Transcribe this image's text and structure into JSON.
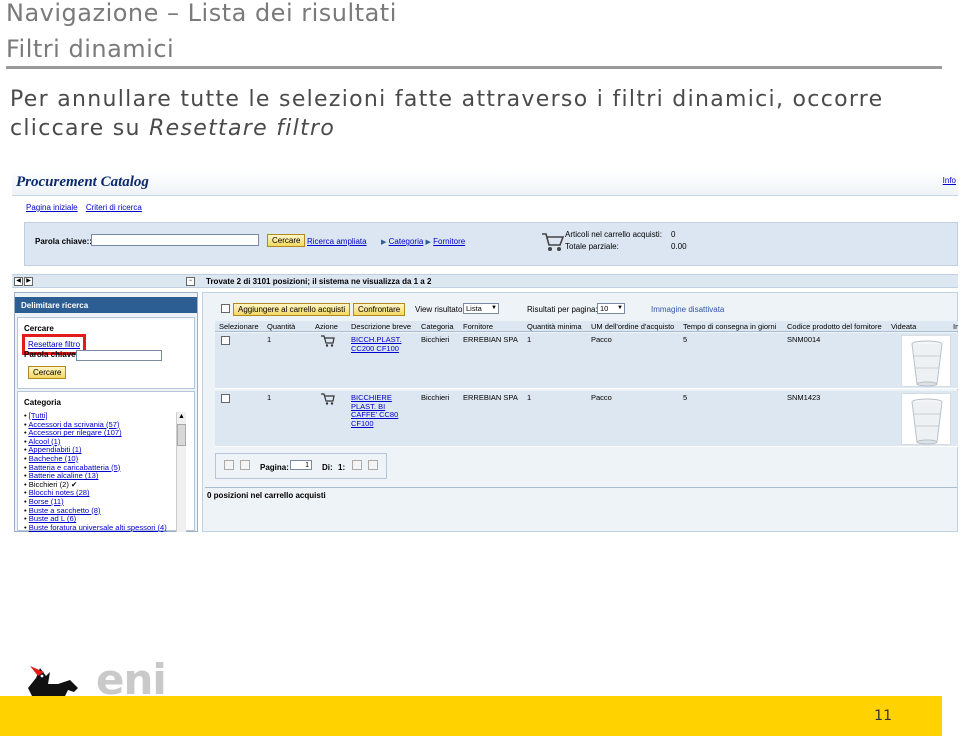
{
  "slide": {
    "title": "Navigazione – Lista dei risultati",
    "subtitle": "Filtri dinamici",
    "body_text": "Per annullare tutte le selezioni fatte attraverso i filtri dinamici, occorre cliccare su",
    "body_emphasis": "Resettare filtro",
    "page_number": "11",
    "logo_text": "eni"
  },
  "app": {
    "title": "Procurement Catalog",
    "info_link": "Info",
    "nav": [
      "Pagina iniziale",
      "Criteri di ricerca"
    ],
    "search": {
      "keyword_label": "Parola chiave::",
      "keyword_value": "",
      "search_button": "Cercare",
      "advanced_search": "Ricerca ampliata",
      "breadcrumb": [
        "Categoria",
        "Fornitore"
      ]
    },
    "cart": {
      "items_label": "Articoli nel carrello acquisti:",
      "items_value": "0",
      "total_label": "Totale parziale:",
      "total_value": "0.00"
    },
    "found_text": "Trovate 2 di 3101 posizioni; il sistema ne visualizza da 1 a 2"
  },
  "left_panel": {
    "header": "Delimitare ricerca",
    "cercare_title": "Cercare",
    "reset_filter": "Resettare filtro",
    "keyword_label": "Parola chiave:",
    "search_button": "Cercare",
    "category_title": "Categoria",
    "categories": [
      "[Tutti]",
      "Accessori da scrivania (57)",
      "Accessori per rilegare (107)",
      "Alcool (1)",
      "Appendiabiti (1)",
      "Bacheche (10)",
      "Batteria e caricabatteria (5)",
      "Batterie alcaline (13)",
      "Bicchieri (2) ✔",
      "Blocchi notes (28)",
      "Borse (11)",
      "Buste a sacchetto (8)",
      "Buste ad L (6)",
      "Buste foratura universale alti spessori (4)"
    ]
  },
  "results": {
    "add_to_cart": "Aggiungere al carrello acquisti",
    "compare": "Confrontare",
    "view_label": "View risultato:",
    "view_value": "Lista",
    "per_page_label": "Risultati per pagina:",
    "per_page_value": "10",
    "image_off": "Immagine disattivata",
    "columns": [
      "Selezionare",
      "Quantità",
      "Azione",
      "Descrizione breve",
      "Categoria",
      "Fornitore",
      "Quantità minima",
      "UM dell'ordine d'acquisto",
      "Tempo di consegna in giorni",
      "Codice prodotto del fornitore",
      "Videata",
      "Im"
    ],
    "rows": [
      {
        "qty": "1",
        "desc": "BICCH.PLAST. CC200 CF100",
        "category": "Bicchieri",
        "supplier": "ERREBIAN SPA",
        "min_qty": "1",
        "uom": "Pacco",
        "lead_time": "5",
        "code": "SNM0014"
      },
      {
        "qty": "1",
        "desc": "BICCHIERE PLAST. BI CAFFE' CC80 CF100",
        "category": "Bicchieri",
        "supplier": "ERREBIAN SPA",
        "min_qty": "1",
        "uom": "Pacco",
        "lead_time": "5",
        "code": "SNM1423"
      }
    ],
    "pager": {
      "page_label": "Pagina:",
      "page_value": "1",
      "of_label": "Di:",
      "total_pages": "1:"
    },
    "cart_status": "0 posizioni nel carrello acquisti"
  }
}
